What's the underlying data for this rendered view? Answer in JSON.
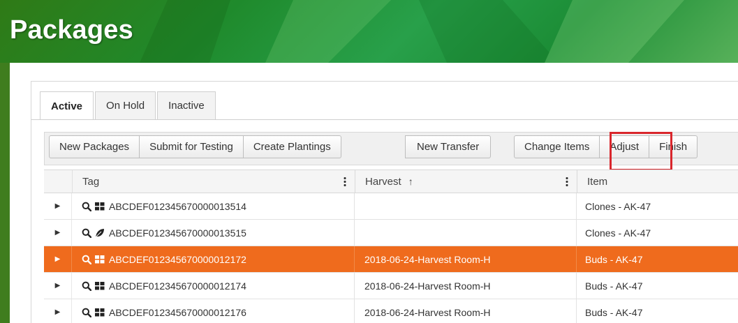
{
  "page": {
    "title": "Packages"
  },
  "tabs": [
    {
      "label": "Active",
      "active": true
    },
    {
      "label": "On Hold",
      "active": false
    },
    {
      "label": "Inactive",
      "active": false
    }
  ],
  "toolbar": {
    "buttons": [
      "New Packages",
      "Submit for Testing",
      "Create Plantings",
      "New Transfer",
      "Change Items",
      "Adjust",
      "Finish"
    ],
    "highlighted": "Adjust",
    "highlight_color": "#d9262c"
  },
  "grid": {
    "columns": [
      {
        "label": "Tag",
        "sort": ""
      },
      {
        "label": "Harvest",
        "sort": "ascending"
      },
      {
        "label": "Item",
        "sort": ""
      }
    ],
    "rows": [
      {
        "tag": "ABCDEF012345670000013514",
        "harvest": "",
        "item": "Clones - AK-47",
        "type_icon": "grid-icon",
        "selected": false
      },
      {
        "tag": "ABCDEF012345670000013515",
        "harvest": "",
        "item": "Clones - AK-47",
        "type_icon": "leaf-icon",
        "selected": false
      },
      {
        "tag": "ABCDEF012345670000012172",
        "harvest": "2018-06-24-Harvest Room-H",
        "item": "Buds - AK-47",
        "type_icon": "grid-icon",
        "selected": true
      },
      {
        "tag": "ABCDEF012345670000012174",
        "harvest": "2018-06-24-Harvest Room-H",
        "item": "Buds - AK-47",
        "type_icon": "grid-icon",
        "selected": false
      },
      {
        "tag": "ABCDEF012345670000012176",
        "harvest": "2018-06-24-Harvest Room-H",
        "item": "Buds - AK-47",
        "type_icon": "grid-icon",
        "selected": false
      }
    ],
    "selected_row_color": "#ef6b1d"
  },
  "colors": {
    "header_green": "#2f7a16",
    "frame_green": "#3f7d1e"
  }
}
